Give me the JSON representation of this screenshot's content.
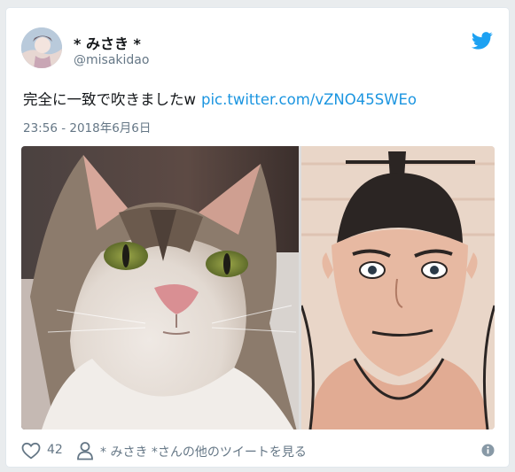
{
  "colors": {
    "brand_blue": "#1da1f2",
    "link_blue": "#1b95e0",
    "text_primary": "#14171a",
    "text_secondary": "#657786"
  },
  "author": {
    "display_name": "* みさき *",
    "handle": "@misakidao",
    "avatar_icon": "user-avatar"
  },
  "tweet": {
    "text": "完全に一致で吹きましたw",
    "link": "pic.twitter.com/vZNO45SWEo",
    "timestamp": "23:56 - 2018年6月6日"
  },
  "media": {
    "left_subject": "cat-photo",
    "right_subject": "illustrated-man"
  },
  "actions": {
    "like_icon": "heart-icon",
    "like_count": "42",
    "profile_icon": "person-icon",
    "profile_link": "* みさき *さんの他のツイートを見る",
    "info_icon": "info-icon"
  }
}
